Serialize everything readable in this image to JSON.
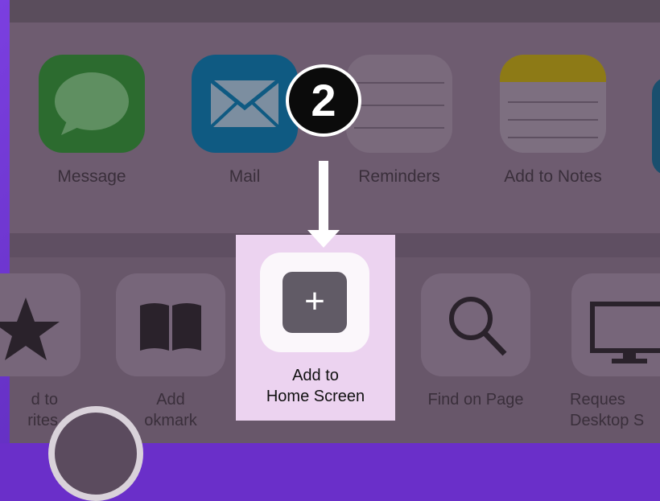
{
  "share_apps": [
    {
      "label": "Message",
      "icon": "message-icon"
    },
    {
      "label": "Mail",
      "icon": "mail-icon"
    },
    {
      "label": "Reminders",
      "icon": "reminders-icon"
    },
    {
      "label": "Add to Notes",
      "icon": "notes-icon"
    }
  ],
  "actions": {
    "favorites_label": "d to\nrites",
    "bookmark_label": "Add\nokmark",
    "home_screen_label": "Add to\nHome Screen",
    "find_label": "Find on Page",
    "desktop_label": "Reques\nDesktop S"
  },
  "annotation": {
    "step_number": "2"
  },
  "colors": {
    "highlight": "#ecd3f0",
    "frame": "#6a2fc9"
  }
}
